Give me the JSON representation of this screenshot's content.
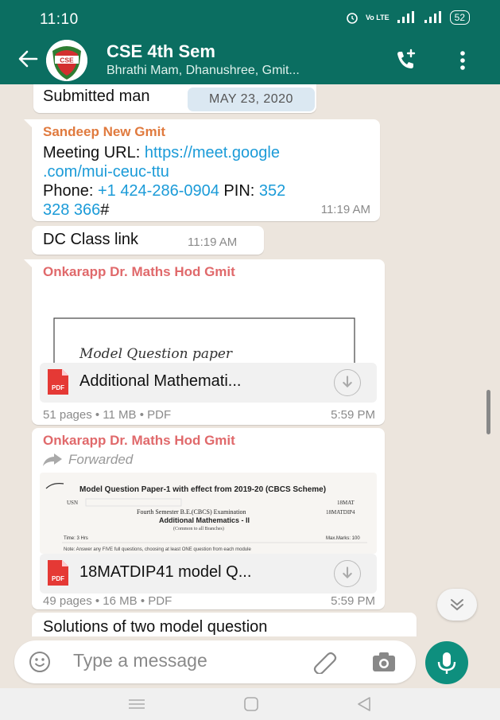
{
  "status_bar": {
    "time": "11:10",
    "network_label": "Vo LTE",
    "battery": "52"
  },
  "header": {
    "avatar_text": "CSE",
    "title": "CSE 4th Sem",
    "subtitle": "Bhrathi Mam, Dhanushree, Gmit..."
  },
  "date_chip": "MAY 23, 2020",
  "messages": [
    {
      "type": "text",
      "text": "Submitted man"
    },
    {
      "type": "text",
      "sender": "Sandeep New Gmit",
      "sender_color": "#e07a3e",
      "line1_prefix": "Meeting URL: ",
      "line1_link": "https://meet.google",
      "line2_link": ".com/mui-ceuc-ttu",
      "line3_prefix": "Phone: ",
      "line3_link": "+1 424-286-0904",
      "line3_mid": " PIN: ",
      "line3_link2": "352",
      "line4_link": "328 366",
      "line4_suffix": "#",
      "time": "11:19 AM"
    },
    {
      "type": "text",
      "text": "DC Class link",
      "time": "11:19 AM"
    },
    {
      "type": "document",
      "sender": "Onkarapp Dr. Maths Hod Gmit",
      "sender_color": "#e0696b",
      "preview_text": "Model Question paper",
      "file_name": "Additional Mathemati...",
      "meta": "51 pages • 11 MB • PDF",
      "time": "5:59 PM"
    },
    {
      "type": "document",
      "sender": "Onkarapp Dr. Maths Hod Gmit",
      "sender_color": "#e0696b",
      "forwarded_label": "Forwarded",
      "preview_title": "Model Question Paper-1 with effect from 2019-20 (CBCS Scheme)",
      "preview_code": "18MAT",
      "preview_code2": "18MATDIP4",
      "preview_usn": "USN",
      "preview_exam": "Fourth Semester B.E.(CBCS) Examination",
      "preview_subject": "Additional Mathematics - II",
      "preview_common": "(Common to all Branches)",
      "preview_time": "Time: 3 Hrs",
      "preview_marks": "Max.Marks: 100",
      "preview_note": "Note: Answer any FIVE full questions, choosing at least ONE question from each module",
      "file_name": "18MATDIP41 model Q...",
      "meta": "49 pages • 16 MB • PDF",
      "time": "5:59 PM"
    },
    {
      "type": "text",
      "text": "Solutions  of two model question"
    }
  ],
  "composer": {
    "placeholder": "Type a message"
  },
  "colors": {
    "header": "#0b6e61",
    "accent": "#0e8f7e",
    "chat_bg": "#ece5dd",
    "link": "#1b9bd8"
  }
}
